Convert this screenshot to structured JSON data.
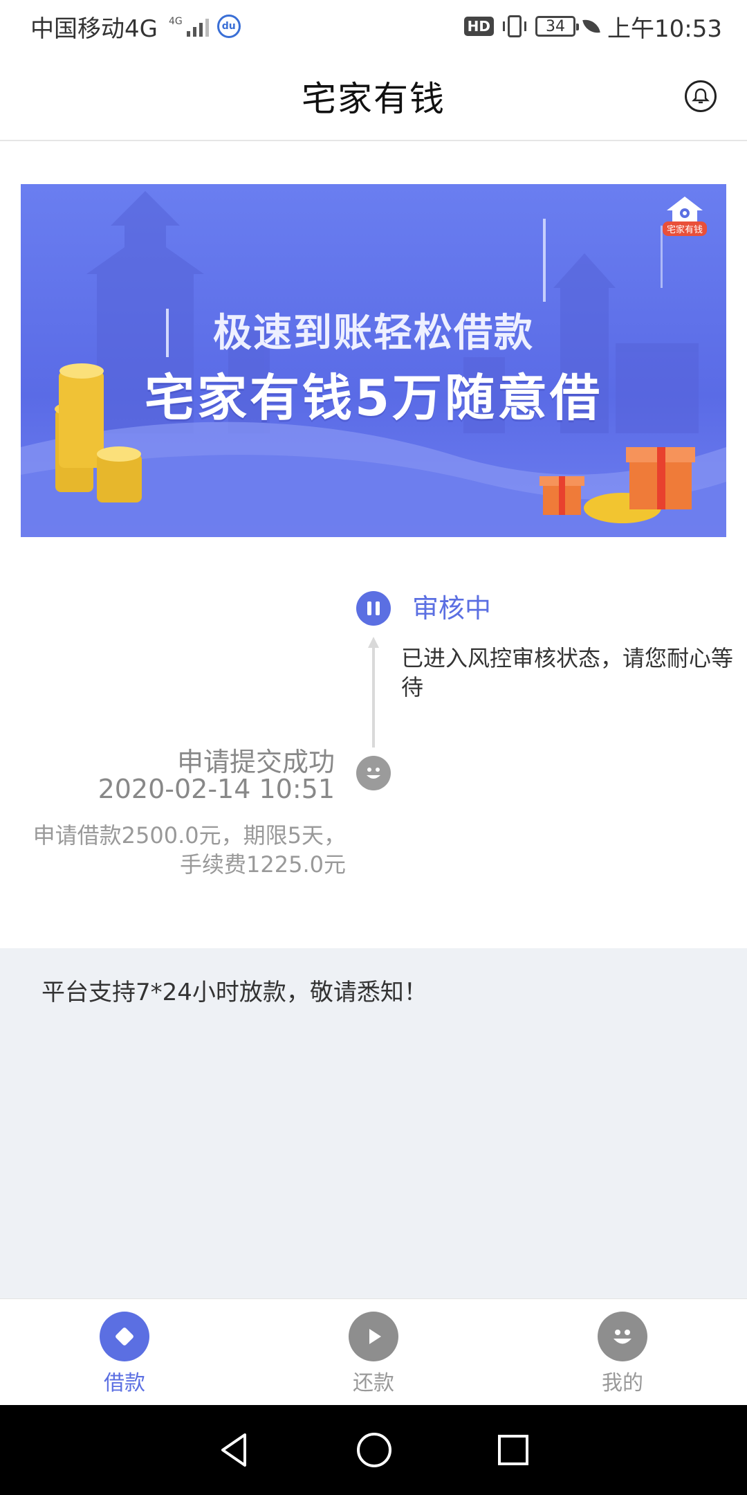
{
  "status_bar": {
    "carrier": "中国移动4G",
    "net_badge": "4G",
    "hd_label": "HD",
    "battery": "34",
    "time": "上午10:53",
    "icons": [
      "signal-bars-icon",
      "baidu-paw-icon",
      "vibrate-icon",
      "battery-icon",
      "leaf-icon"
    ]
  },
  "header": {
    "title": "宅家有钱",
    "right_icon": "bell-icon"
  },
  "banner": {
    "line1": "极速到账轻松借款",
    "line2": "宅家有钱5万随意借",
    "logo_text": "宅家有钱",
    "bg_color": "#5a6be6"
  },
  "timeline": {
    "active": {
      "status": "审核中",
      "desc": "已进入风控审核状态，请您耐心等待",
      "icon": "pause-icon",
      "color": "#5b6fe2"
    },
    "done": {
      "title": "申请提交成功",
      "time": "2020-02-14 10:51",
      "detail": "申请借款2500.0元，期限5天，手续费1225.0元",
      "icon": "smiley-icon"
    }
  },
  "notice": {
    "text": "平台支持7*24小时放款，敬请悉知！"
  },
  "bottom_nav": {
    "items": [
      {
        "label": "借款",
        "icon": "diamond-icon",
        "active": true
      },
      {
        "label": "还款",
        "icon": "play-icon",
        "active": false
      },
      {
        "label": "我的",
        "icon": "smiley-icon",
        "active": false
      }
    ],
    "accent": "#5b6fe2"
  },
  "system_nav": {
    "icons": [
      "back-icon",
      "home-icon",
      "recents-icon"
    ]
  }
}
